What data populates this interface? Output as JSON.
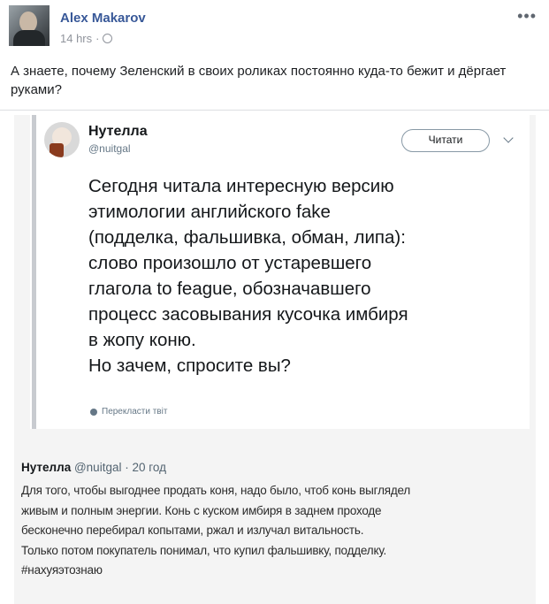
{
  "post": {
    "author": "Alex Makarov",
    "time": "14 hrs",
    "separator": "·",
    "more_label": "•••",
    "text": "А знаете, почему Зеленский в своих роликах постоянно куда-то бежит и дёргает руками?"
  },
  "tweet": {
    "name": "Нутелла",
    "handle": "@nuitgal",
    "follow_label": "Читати",
    "body": "Сегодня читала интересную версию\nэтимологии английского fake\n(подделка, фальшивка, обман, липа):\nслово произошло от устаревшего\nглагола to feague, обозначавшего\nпроцесс засовывания кусочка имбиря\nв жопу коню.\nНо зачем, спросите вы?",
    "translate_label": "Перекласти твіт"
  },
  "reply": {
    "name": "Нутелла",
    "handle": "@nuitgal",
    "separator": "·",
    "time": "20 год",
    "body": "Для того, чтобы выгоднее продать коня, надо было, чтоб конь выглядел\nживым и полным энергии. Конь с куском имбиря в заднем проходе\nбесконечно перебирал копытами, ржал и излучал витальность.\nТолько потом покупатель понимал, что купил фальшивку, подделку.\n#нахуяэтознаю"
  },
  "icons": {
    "more": "more-options-icon",
    "audience": "globe-icon",
    "follow_dropdown": "chevron-down-icon",
    "translate": "globe-icon"
  },
  "colors": {
    "author_link": "#385898",
    "meta_gray": "#90949c",
    "tweet_text": "#14171a",
    "tweet_gray": "#657786"
  }
}
